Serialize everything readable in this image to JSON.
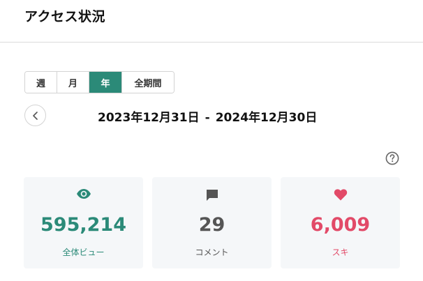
{
  "header": {
    "title": "アクセス状況"
  },
  "period_tabs": [
    {
      "label": "週",
      "active": false
    },
    {
      "label": "月",
      "active": false
    },
    {
      "label": "年",
      "active": true
    },
    {
      "label": "全期間",
      "active": false
    }
  ],
  "date_range": {
    "start": "2023年12月31日",
    "separator": "-",
    "end": "2024年12月30日"
  },
  "help_icon": "question-circle-icon",
  "stats": {
    "views": {
      "icon": "eye-icon",
      "value": "595,214",
      "label": "全体ビュー",
      "color": "#2b8a78"
    },
    "comments": {
      "icon": "comment-icon",
      "value": "29",
      "label": "コメント",
      "color": "#555555"
    },
    "likes": {
      "icon": "heart-icon",
      "value": "6,009",
      "label": "スキ",
      "color": "#e24a68"
    }
  },
  "colors": {
    "accent": "#2b8a78",
    "card_bg": "#f5f7f9",
    "like": "#e24a68"
  }
}
